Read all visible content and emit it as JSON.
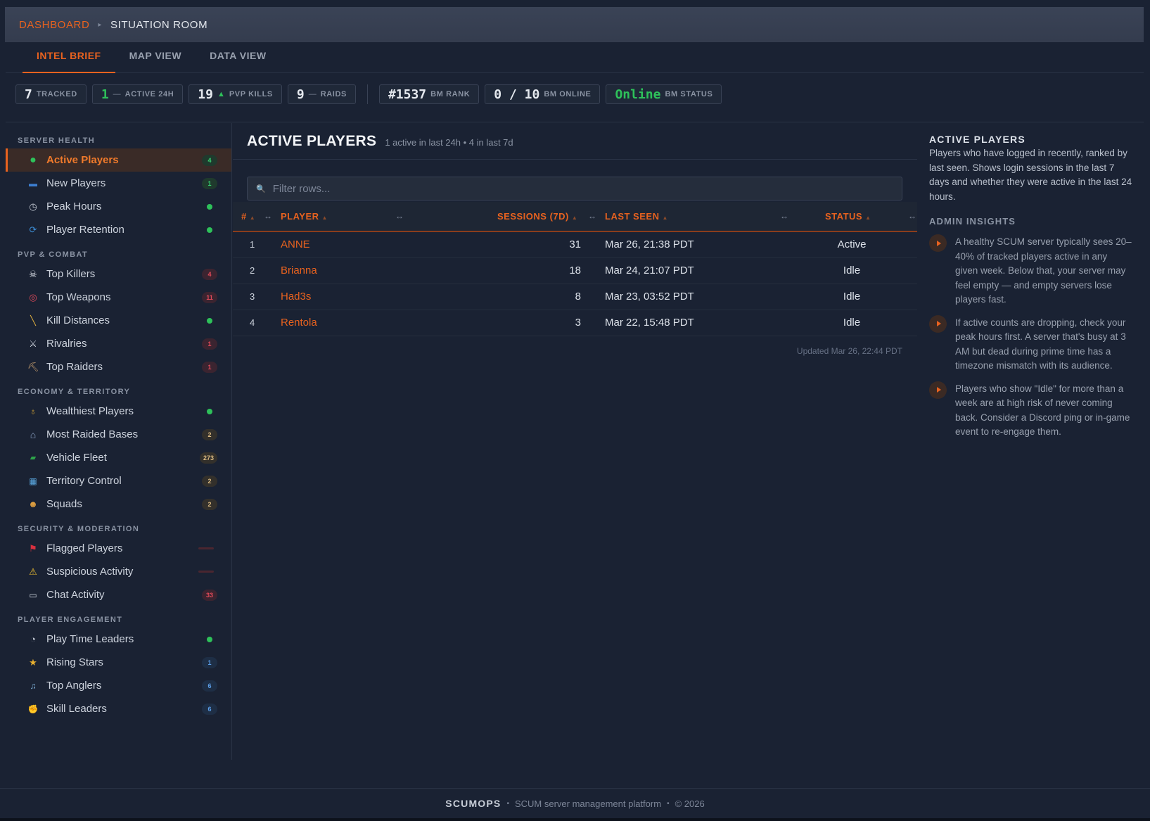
{
  "breadcrumb": {
    "home": "DASHBOARD",
    "separator": "▸",
    "current": "SITUATION ROOM"
  },
  "tabs": [
    {
      "label": "INTEL BRIEF",
      "active": true
    },
    {
      "label": "MAP VIEW",
      "active": false
    },
    {
      "label": "DATA VIEW",
      "active": false
    }
  ],
  "stats": [
    {
      "value": "7",
      "label": "TRACKED"
    },
    {
      "value": "1",
      "prefix": "—",
      "label": "ACTIVE 24H"
    },
    {
      "value": "19",
      "prefix": "▲",
      "label": "PVP KILLS"
    },
    {
      "value": "9",
      "prefix": "—",
      "label": "RAIDS"
    },
    {
      "value": "#1537",
      "label": "BM RANK"
    },
    {
      "value": "0 / 10",
      "label": "BM ONLINE"
    },
    {
      "value": "Online",
      "label": "BM STATUS"
    }
  ],
  "sidebar": {
    "sections": [
      {
        "title": "SERVER HEALTH",
        "items": [
          {
            "label": "Active Players",
            "icon": "green-circle-icon",
            "badge": "4",
            "badge_type": "green",
            "active": true
          },
          {
            "label": "New Players",
            "icon": "new-badge-icon",
            "badge": "1",
            "badge_type": "green"
          },
          {
            "label": "Peak Hours",
            "icon": "clock-icon",
            "badge": "",
            "badge_type": "dot"
          },
          {
            "label": "Player Retention",
            "icon": "cycle-icon",
            "badge": "",
            "badge_type": "dot"
          }
        ]
      },
      {
        "title": "PVP & COMBAT",
        "items": [
          {
            "label": "Top Killers",
            "icon": "skull-icon",
            "badge": "4",
            "badge_type": "red"
          },
          {
            "label": "Top Weapons",
            "icon": "target-icon",
            "badge": "11",
            "badge_type": "red"
          },
          {
            "label": "Kill Distances",
            "icon": "ruler-icon",
            "badge": "",
            "badge_type": "dot"
          },
          {
            "label": "Rivalries",
            "icon": "crossed-swords-icon",
            "badge": "1",
            "badge_type": "red"
          },
          {
            "label": "Top Raiders",
            "icon": "pickaxe-icon",
            "badge": "1",
            "badge_type": "red"
          }
        ]
      },
      {
        "title": "ECONOMY & TERRITORY",
        "items": [
          {
            "label": "Wealthiest Players",
            "icon": "money-bag-icon",
            "badge": "",
            "badge_type": "dot"
          },
          {
            "label": "Most Raided Bases",
            "icon": "house-icon",
            "badge": "2",
            "badge_type": "tan"
          },
          {
            "label": "Vehicle Fleet",
            "icon": "vehicle-icon",
            "badge": "273",
            "badge_type": "tan"
          },
          {
            "label": "Territory Control",
            "icon": "map-icon",
            "badge": "2",
            "badge_type": "tan"
          },
          {
            "label": "Squads",
            "icon": "people-icon",
            "badge": "2",
            "badge_type": "tan"
          }
        ]
      },
      {
        "title": "SECURITY & MODERATION",
        "items": [
          {
            "label": "Flagged Players",
            "icon": "red-flag-icon",
            "badge": "",
            "badge_type": "bar"
          },
          {
            "label": "Suspicious Activity",
            "icon": "warning-icon",
            "badge": "",
            "badge_type": "bar"
          },
          {
            "label": "Chat Activity",
            "icon": "chat-bubble-icon",
            "badge": "33",
            "badge_type": "red"
          }
        ]
      },
      {
        "title": "PLAYER ENGAGEMENT",
        "items": [
          {
            "label": "Play Time Leaders",
            "icon": "stopwatch-icon",
            "badge": "",
            "badge_type": "dot"
          },
          {
            "label": "Rising Stars",
            "icon": "star-icon",
            "badge": "1",
            "badge_type": "blue"
          },
          {
            "label": "Top Anglers",
            "icon": "fishing-icon",
            "badge": "6",
            "badge_type": "blue"
          },
          {
            "label": "Skill Leaders",
            "icon": "flexed-arm-icon",
            "badge": "6",
            "badge_type": "blue"
          }
        ]
      }
    ]
  },
  "main": {
    "title": "ACTIVE PLAYERS",
    "subtitle": "1 active in last 24h • 4 in last 7d",
    "filter_placeholder": "Filter rows...",
    "columns": [
      "#",
      "PLAYER",
      "SESSIONS (7D)",
      "LAST SEEN",
      "STATUS"
    ],
    "grip": "↔",
    "rows": [
      {
        "rank": "1",
        "player": "ANNE",
        "sessions": "31",
        "last_seen": "Mar 26, 21:38 PDT",
        "status": "Active"
      },
      {
        "rank": "2",
        "player": "Brianna",
        "sessions": "18",
        "last_seen": "Mar 24, 21:07 PDT",
        "status": "Idle"
      },
      {
        "rank": "3",
        "player": "Had3s",
        "sessions": "8",
        "last_seen": "Mar 23, 03:52 PDT",
        "status": "Idle"
      },
      {
        "rank": "4",
        "player": "Rentola",
        "sessions": "3",
        "last_seen": "Mar 22, 15:48 PDT",
        "status": "Idle"
      }
    ],
    "updated": "Updated Mar 26, 22:44 PDT"
  },
  "right_panel": {
    "title": "ACTIVE PLAYERS",
    "description": "Players who have logged in recently, ranked by last seen. Shows login sessions in the last 7 days and whether they were active in the last 24 hours.",
    "insights_title": "ADMIN INSIGHTS",
    "insights": [
      "A healthy SCUM server typically sees 20–40% of tracked players active in any given week. Below that, your server may feel empty — and empty servers lose players fast.",
      "If active counts are dropping, check your peak hours first. A server that's busy at 3 AM but dead during prime time has a timezone mismatch with its audience.",
      "Players who show \"Idle\" for more than a week are at high risk of never coming back. Consider a Discord ping or in-game event to re-engage them."
    ]
  },
  "footer": {
    "brand": "SCUMOPS",
    "tagline": "SCUM server management platform",
    "copyright": "© 2026"
  },
  "colors": {
    "accent": "#e8621f",
    "online_green": "#2ec15a",
    "background": "#1a2233"
  }
}
